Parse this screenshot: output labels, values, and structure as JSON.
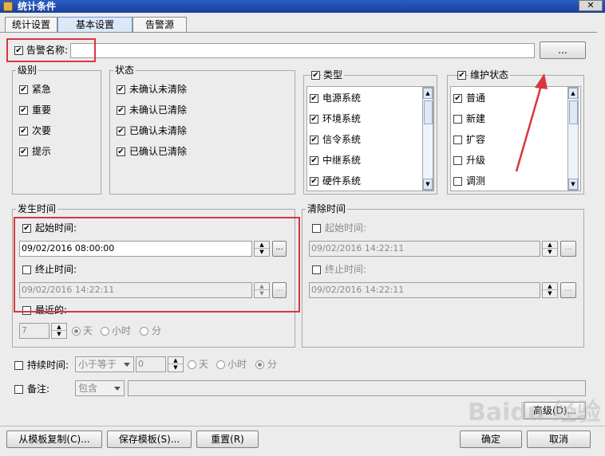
{
  "window": {
    "title": "统计条件",
    "close_glyph": "✕"
  },
  "tabs": [
    "统计设置",
    "基本设置",
    "告警源"
  ],
  "alarm_name": {
    "label": "告警名称:",
    "checked": true,
    "browse_label": "..."
  },
  "level": {
    "title": "级别",
    "items": [
      "紧急",
      "重要",
      "次要",
      "提示"
    ]
  },
  "state": {
    "title": "状态",
    "items": [
      "未确认未清除",
      "未确认已清除",
      "已确认未清除",
      "已确认已清除"
    ]
  },
  "type": {
    "title": "类型",
    "items": [
      "电源系统",
      "环境系统",
      "信令系统",
      "中继系统",
      "硬件系统"
    ]
  },
  "maint": {
    "title": "维护状态",
    "items": [
      "普通",
      "新建",
      "扩容",
      "升级",
      "调测"
    ],
    "checked": [
      true,
      false,
      false,
      false,
      false
    ]
  },
  "occur": {
    "title": "发生时间",
    "start_label": "起始时间:",
    "start_value": "09/02/2016 08:00:00",
    "end_label": "终止时间:",
    "end_value": "09/02/2016 14:22:11",
    "recent_label": "最近的:",
    "recent_value": "7",
    "units": [
      "天",
      "小时",
      "分"
    ]
  },
  "clear": {
    "title": "清除时间",
    "start_label": "起始时间:",
    "start_value": "09/02/2016 14:22:11",
    "end_label": "终止时间:",
    "end_value": "09/02/2016 14:22:11"
  },
  "duration": {
    "label": "持续时间:",
    "op": "小于等于",
    "value": "0",
    "units": [
      "天",
      "小时",
      "分"
    ]
  },
  "note": {
    "label": "备注:",
    "op": "包含"
  },
  "buttons": {
    "advanced": "高级(D)...",
    "copy_template": "从模板复制(C)...",
    "save_template": "保存模板(S)...",
    "reset": "重置(R)",
    "ok": "确定",
    "cancel": "取消"
  },
  "ellipsis": "...",
  "check_glyph": "✔",
  "colors": {
    "titlebar": "#1f4fb3",
    "annotation_red": "#d9363e"
  },
  "watermark": "Baidu 经验"
}
